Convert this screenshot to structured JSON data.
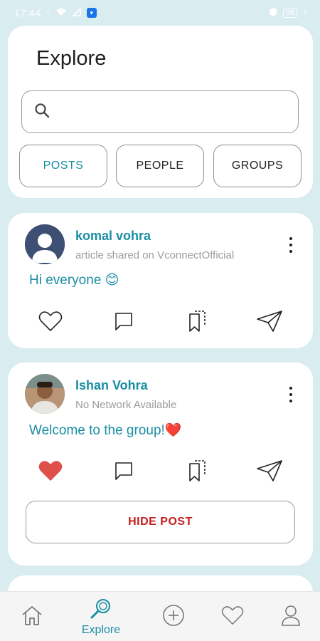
{
  "status_bar": {
    "time": "17:44",
    "battery": "59"
  },
  "explore": {
    "title": "Explore",
    "search_placeholder": "",
    "tabs": [
      {
        "label": "POSTS",
        "active": true
      },
      {
        "label": "PEOPLE",
        "active": false
      },
      {
        "label": "GROUPS",
        "active": false
      }
    ]
  },
  "posts": [
    {
      "author": "komal vohra",
      "subtitle": "article shared on VconnectOfficial",
      "text": "Hi everyone 😊",
      "liked": false,
      "avatar": "default-avatar-icon"
    },
    {
      "author": "Ishan Vohra",
      "subtitle": "No Network Available",
      "text": "Welcome to the group!❤️",
      "liked": true,
      "avatar": "user-photo",
      "hide_label": "HIDE POST"
    }
  ],
  "bottom_nav": {
    "items": [
      {
        "icon": "home-icon",
        "label": ""
      },
      {
        "icon": "explore-icon",
        "label": "Explore",
        "active": true
      },
      {
        "icon": "add-icon",
        "label": ""
      },
      {
        "icon": "heart-icon",
        "label": ""
      },
      {
        "icon": "profile-icon",
        "label": ""
      }
    ]
  },
  "colors": {
    "accent": "#1a8ea3",
    "background": "#d9ecf0",
    "like_red": "#e0504a",
    "hide_red": "#c41e1e"
  }
}
